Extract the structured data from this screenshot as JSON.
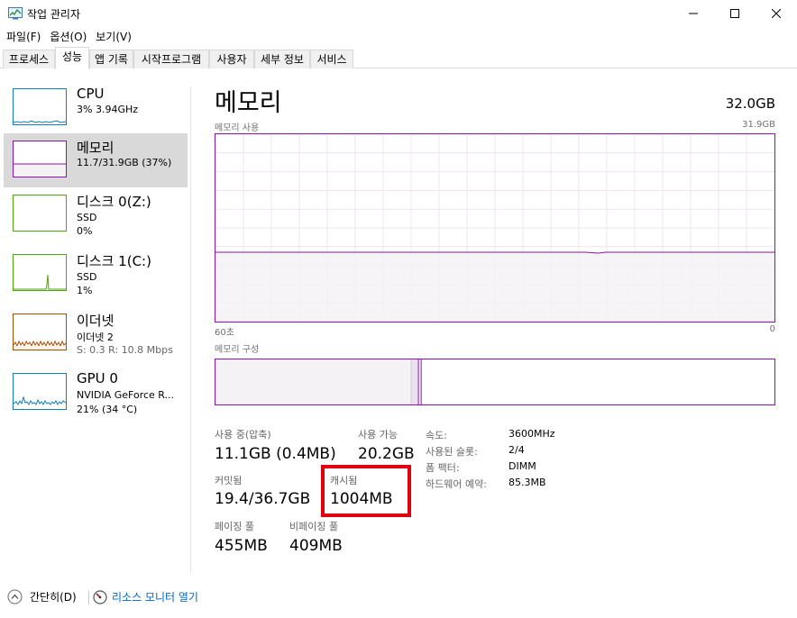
{
  "window": {
    "title": "작업 관리자",
    "app_icon": "task-manager-icon",
    "controls": [
      "minimize-icon",
      "maximize-icon",
      "close-icon"
    ]
  },
  "menu": {
    "items": [
      "파일(F)",
      "옵션(O)",
      "보기(V)"
    ]
  },
  "tabs": [
    {
      "label": "프로세스",
      "active": false
    },
    {
      "label": "성능",
      "active": true
    },
    {
      "label": "앱 기록",
      "active": false
    },
    {
      "label": "시작프로그램",
      "active": false
    },
    {
      "label": "사용자",
      "active": false
    },
    {
      "label": "세부 정보",
      "active": false
    },
    {
      "label": "서비스",
      "active": false
    }
  ],
  "resources": [
    {
      "name": "CPU",
      "line1": "3% 3.94GHz",
      "line2": "",
      "color": "#117dbb",
      "selected": false
    },
    {
      "name": "메모리",
      "line1": "11.7/31.9GB (37%)",
      "line2": "",
      "color": "#8b12ae",
      "selected": true
    },
    {
      "name": "디스크 0(Z:)",
      "line1": "SSD",
      "line2": "0%",
      "color": "#4da60c",
      "selected": false
    },
    {
      "name": "디스크 1(C:)",
      "line1": "SSD",
      "line2": "1%",
      "color": "#4da60c",
      "selected": false
    },
    {
      "name": "이더넷",
      "line1": "이더넷 2",
      "line2": "S: 0.3  R: 10.8 Mbps",
      "color": "#a74f01",
      "selected": false
    },
    {
      "name": "GPU 0",
      "line1": "NVIDIA GeForce R...",
      "line2": "21% (34 °C)",
      "color": "#117dbb",
      "selected": false
    }
  ],
  "memory": {
    "title": "메모리",
    "total": "32.0GB",
    "usage_label": "메모리 사용",
    "usage_max": "31.9GB",
    "time_left": "60초",
    "time_right": "0",
    "composition_label": "메모리 구성",
    "usage_fraction": 0.37,
    "composition": {
      "in_use": 0.35,
      "modified": 0.013,
      "standby": 0.005
    },
    "accent": "#8b12ae",
    "stats": {
      "in_use_label": "사용 중(압축)",
      "in_use_value": "11.1GB (0.4MB)",
      "available_label": "사용 가능",
      "available_value": "20.2GB",
      "committed_label": "커밋됨",
      "committed_value": "19.4/36.7GB",
      "cached_label": "캐시됨",
      "cached_value": "1004MB",
      "paged_label": "페이징 풀",
      "paged_value": "455MB",
      "nonpaged_label": "비페이징 풀",
      "nonpaged_value": "409MB"
    },
    "info": [
      {
        "label": "속도:",
        "value": "3600MHz"
      },
      {
        "label": "사용된 슬롯:",
        "value": "2/4"
      },
      {
        "label": "폼 팩터:",
        "value": "DIMM"
      },
      {
        "label": "하드웨어 예약:",
        "value": "85.3MB"
      }
    ],
    "highlight_color": "#e0000f"
  },
  "footer": {
    "collapse_label": "간단히(D)",
    "collapse_icon": "chevron-up-circle-icon",
    "resmon_label": "리소스 모니터 열기",
    "resmon_icon": "resource-monitor-icon"
  }
}
